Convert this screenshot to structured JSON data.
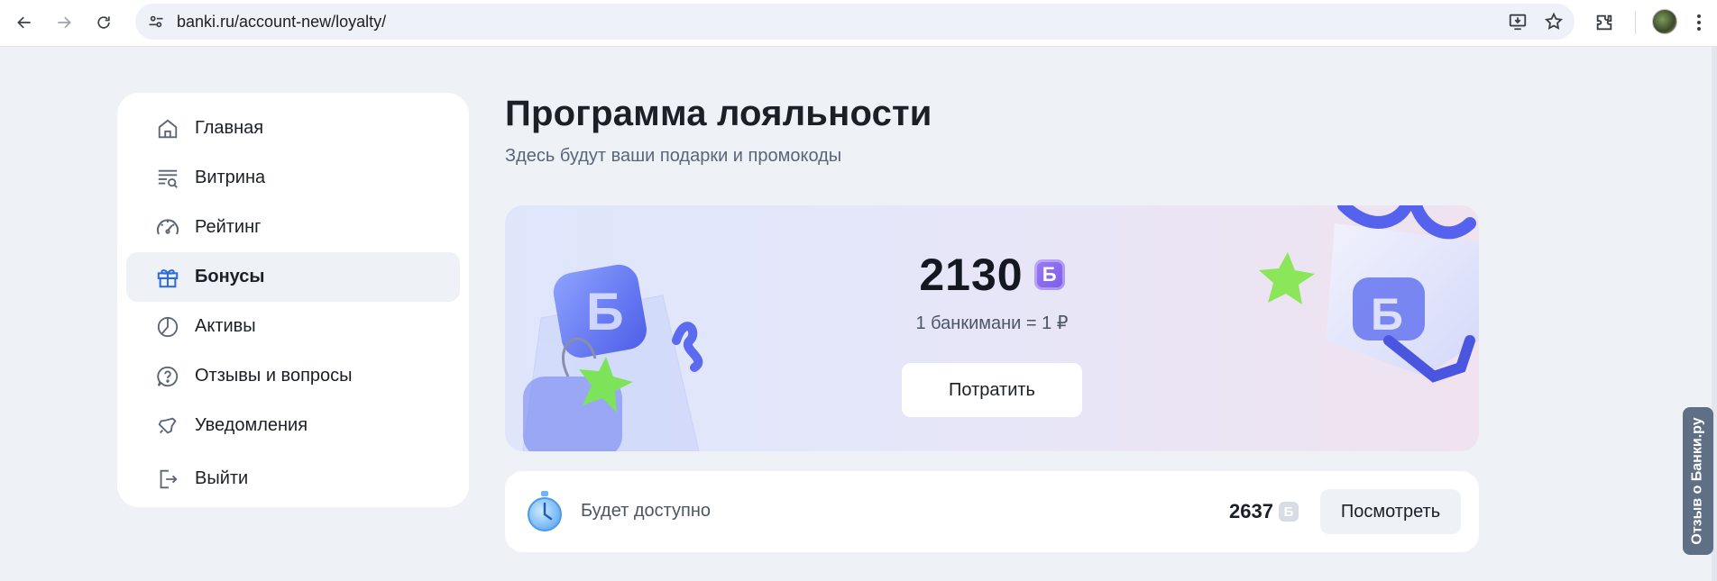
{
  "browser": {
    "url": "banki.ru/account-new/loyalty/"
  },
  "sidebar": {
    "items": [
      {
        "label": "Главная",
        "icon": "home-icon",
        "active": false
      },
      {
        "label": "Витрина",
        "icon": "showcase-search-icon",
        "active": false
      },
      {
        "label": "Рейтинг",
        "icon": "gauge-icon",
        "active": false
      },
      {
        "label": "Бонусы",
        "icon": "gift-icon",
        "active": true
      },
      {
        "label": "Активы",
        "icon": "pie-chart-icon",
        "active": false
      },
      {
        "label": "Отзывы и вопросы",
        "icon": "question-bubble-icon",
        "active": false
      },
      {
        "label": "Уведомления",
        "icon": "bell-icon",
        "active": false
      },
      {
        "label": "Выйти",
        "icon": "logout-icon",
        "active": false
      }
    ]
  },
  "main": {
    "title": "Программа лояльности",
    "subtitle": "Здесь будут ваши подарки и промокоды",
    "balance": {
      "amount": "2130",
      "currency_glyph": "Б",
      "rate": "1 банкимани = 1 ₽",
      "spend_label": "Потратить"
    },
    "future": {
      "label": "Будет доступно",
      "amount": "2637",
      "currency_glyph": "Б",
      "view_label": "Посмотреть"
    }
  },
  "feedback_tab": {
    "label": "Отзыв о Банки.ру"
  },
  "colors": {
    "page_bg": "#eef2f7",
    "accent_purple": "#8a6bf0",
    "active_icon_blue": "#2f6bd8",
    "feedback_bg": "#5e6f86"
  }
}
